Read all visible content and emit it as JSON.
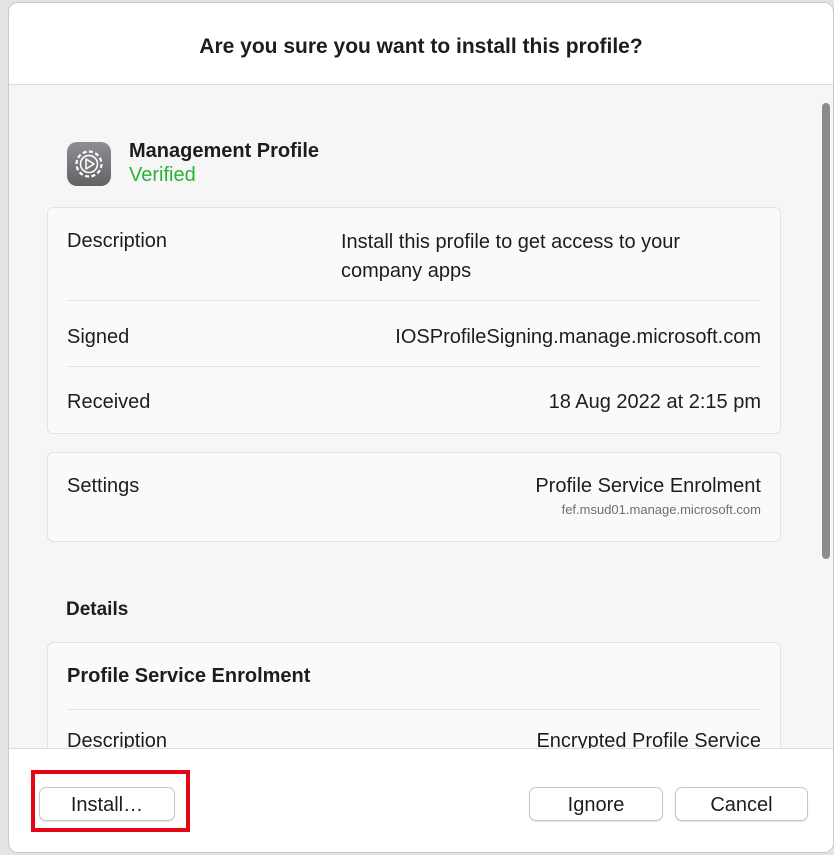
{
  "dialog": {
    "title": "Are you sure you want to install this profile?"
  },
  "profile": {
    "icon": "settings-gear-icon",
    "name": "Management Profile",
    "status": "Verified",
    "status_color": "#28b43a"
  },
  "info": {
    "description_label": "Description",
    "description_value": "Install this profile to get access to your company apps",
    "signed_label": "Signed",
    "signed_value": "IOSProfileSigning.manage.microsoft.com",
    "received_label": "Received",
    "received_value": "18 Aug 2022 at 2:15 pm"
  },
  "settings": {
    "label": "Settings",
    "value": "Profile Service Enrolment",
    "sub_value": "fef.msud01.manage.microsoft.com"
  },
  "details": {
    "section_title": "Details",
    "entry_title": "Profile Service Enrolment",
    "description_label": "Description",
    "description_value": "Encrypted Profile Service"
  },
  "footer": {
    "install_label": "Install…",
    "ignore_label": "Ignore",
    "cancel_label": "Cancel",
    "highlight_color": "#e30613"
  }
}
